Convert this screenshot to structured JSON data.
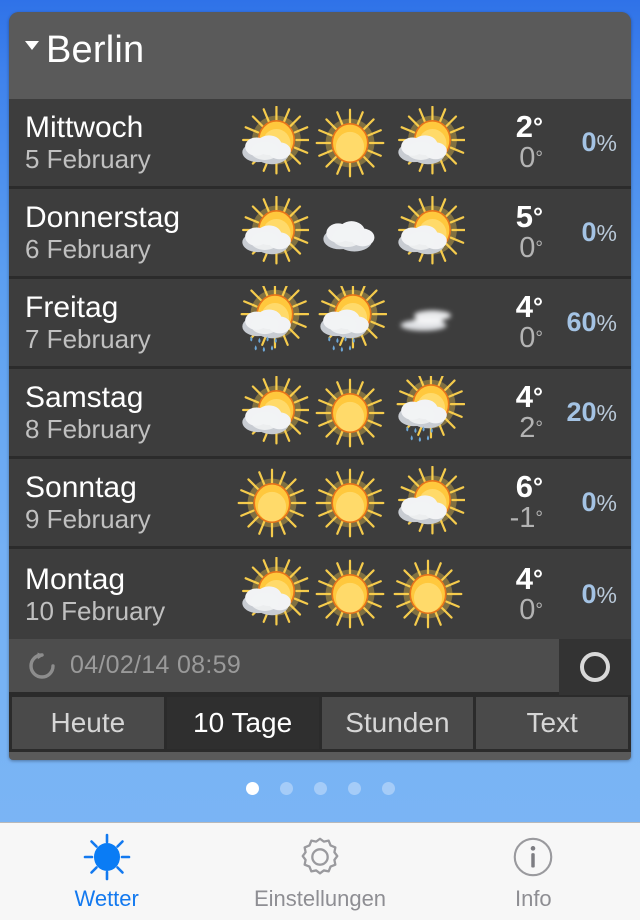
{
  "header": {
    "city": "Berlin",
    "caret_icon": "chevron-down-icon"
  },
  "forecast": {
    "rows": [
      {
        "day": "Mittwoch",
        "date": "5 February",
        "icons": [
          "sun-cloud-icon",
          "sun-icon",
          "sun-cloud-icon"
        ],
        "high": "2",
        "low": "0",
        "precip": "0",
        "deg": "°",
        "pct": "%"
      },
      {
        "day": "Donnerstag",
        "date": "6 February",
        "icons": [
          "sun-cloud-icon",
          "cloud-icon",
          "sun-cloud-icon"
        ],
        "high": "5",
        "low": "0",
        "precip": "0",
        "deg": "°",
        "pct": "%"
      },
      {
        "day": "Freitag",
        "date": "7 February",
        "icons": [
          "rain-icon",
          "rain-icon",
          "fog-icon"
        ],
        "high": "4",
        "low": "0",
        "precip": "60",
        "deg": "°",
        "pct": "%"
      },
      {
        "day": "Samstag",
        "date": "8 February",
        "icons": [
          "sun-cloud-icon",
          "sun-icon",
          "rain-icon"
        ],
        "high": "4",
        "low": "2",
        "precip": "20",
        "deg": "°",
        "pct": "%"
      },
      {
        "day": "Sonntag",
        "date": "9 February",
        "icons": [
          "sun-icon",
          "sun-icon",
          "sun-cloud-icon"
        ],
        "high": "6",
        "low": "-1",
        "precip": "0",
        "deg": "°",
        "pct": "%"
      },
      {
        "day": "Montag",
        "date": "10 February",
        "icons": [
          "sun-cloud-icon",
          "sun-icon",
          "sun-icon"
        ],
        "high": "4",
        "low": "0",
        "precip": "0",
        "deg": "°",
        "pct": "%"
      }
    ]
  },
  "refresh": {
    "icon": "refresh-arrow-icon",
    "timestamp": "04/02/14 08:59",
    "button_icon": "circle-icon"
  },
  "segmented": {
    "options": [
      "Heute",
      "10 Tage",
      "Stunden",
      "Text"
    ],
    "selected_index": 1
  },
  "pager": {
    "count": 5,
    "active_index": 0
  },
  "tabbar": {
    "items": [
      {
        "label": "Wetter",
        "icon": "sun-icon",
        "active": true
      },
      {
        "label": "Einstellungen",
        "icon": "gear-icon",
        "active": false
      },
      {
        "label": "Info",
        "icon": "info-icon",
        "active": false
      }
    ]
  },
  "colors": {
    "background_blue": "#5b9ef0",
    "card_gray": "#5a5a5a",
    "row_gray": "#3d3d3d",
    "precip_blue": "#a4c3e4",
    "accent_blue": "#1379ef"
  }
}
